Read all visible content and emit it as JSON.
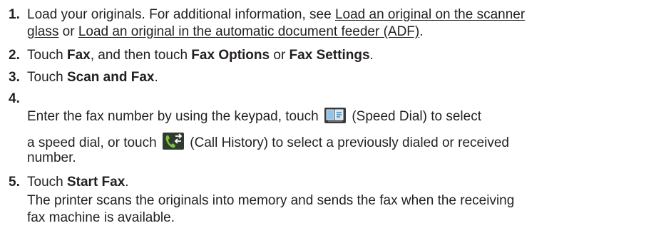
{
  "steps": [
    {
      "number": "1.",
      "line1_text": "Load your originals. For additional information, see ",
      "link1": "Load an original on the scanner",
      "link1_cont": "glass",
      "mid": " or ",
      "link2": "Load an original in the automatic document feeder (ADF)",
      "end": "."
    },
    {
      "number": "2.",
      "pre": "Touch ",
      "b1": "Fax",
      "mid": ", and then touch ",
      "b2": "Fax Options",
      "mid2": " or ",
      "b3": "Fax Settings",
      "end": "."
    },
    {
      "number": "3.",
      "pre": "Touch ",
      "b1": "Scan and Fax",
      "end": "."
    },
    {
      "number": "4.",
      "line1_pre": "Enter the fax number by using the keypad, touch",
      "line1_post": "(Speed Dial) to select",
      "line2_pre": "a speed dial, or touch",
      "line2_post": "(Call History) to select a previously dialed or received",
      "line3": "number.",
      "icons": [
        "speed-dial-icon",
        "call-history-icon"
      ]
    },
    {
      "number": "5.",
      "pre": "Touch ",
      "b1": "Start Fax",
      "end": ".",
      "note_line1": "The printer scans the originals into memory and sends the fax when the receiving",
      "note_line2": "fax machine is available."
    }
  ]
}
